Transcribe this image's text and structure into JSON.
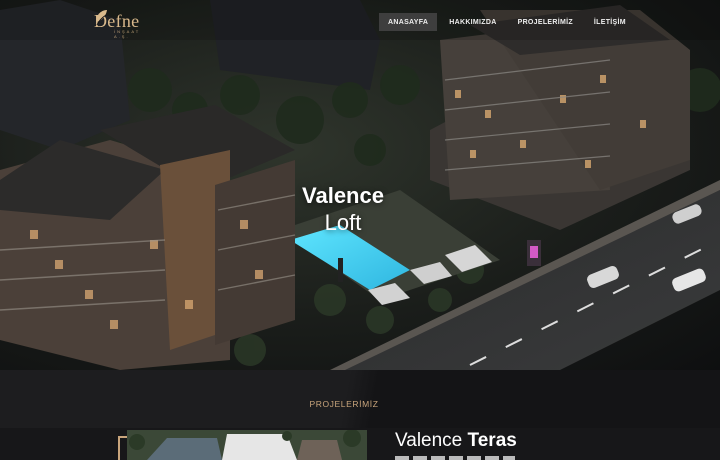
{
  "brand": {
    "name": "Defne",
    "tagline": "İNŞAAT A.Ş.",
    "color": "#d9b98c"
  },
  "nav": {
    "items": [
      {
        "label": "ANASAYFA",
        "active": true
      },
      {
        "label": "HAKKIMIZDA",
        "active": false
      },
      {
        "label": "PROJELERİMİZ",
        "active": false
      },
      {
        "label": "İLETİŞİM",
        "active": false
      }
    ]
  },
  "hero": {
    "title_line1": "Valence",
    "title_line2": "Loft"
  },
  "projects": {
    "heading": "PROJELERİMİZ",
    "accent": "#c9a57c",
    "featured": {
      "name_light": "Valence",
      "name_bold": "Teras"
    }
  }
}
